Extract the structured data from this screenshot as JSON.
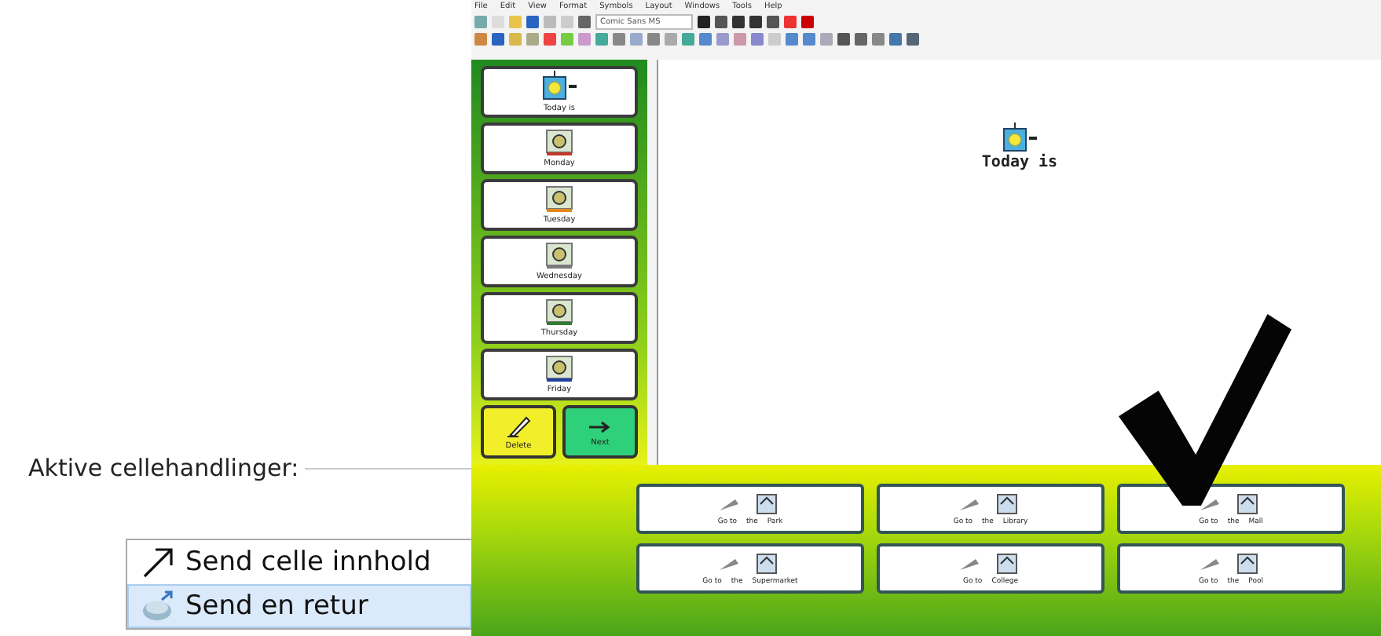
{
  "settings_panel": {
    "title": "Aktive cellehandlinger:",
    "actions": [
      {
        "label": "Send celle innhold",
        "selected": false
      },
      {
        "label": "Send en retur",
        "selected": true
      }
    ]
  },
  "editor": {
    "menu": [
      "File",
      "Edit",
      "View",
      "Format",
      "Symbols",
      "Layout",
      "Windows",
      "Tools",
      "Help"
    ],
    "font_name": "Comic Sans MS",
    "day_cells": [
      {
        "label": "Today is",
        "kind": "sun"
      },
      {
        "label": "Monday",
        "kind": "day",
        "color": "#c0392b"
      },
      {
        "label": "Tuesday",
        "kind": "day",
        "color": "#e08a1e"
      },
      {
        "label": "Wednesday",
        "kind": "day",
        "color": "#7a7a7a"
      },
      {
        "label": "Thursday",
        "kind": "day",
        "color": "#2e7d32"
      },
      {
        "label": "Friday",
        "kind": "day",
        "color": "#1f3fa0"
      }
    ],
    "tool_cells": [
      {
        "label": "Delete",
        "kind": "delete"
      },
      {
        "label": "Next",
        "kind": "next"
      }
    ],
    "document": {
      "text": "Today is"
    },
    "place_cells": [
      {
        "words": [
          "Go to",
          "the",
          "Park"
        ]
      },
      {
        "words": [
          "Go to",
          "the",
          "Library"
        ]
      },
      {
        "words": [
          "Go to",
          "the",
          "Mall"
        ]
      },
      {
        "words": [
          "Go to",
          "the",
          "Supermarket"
        ]
      },
      {
        "words": [
          "Go to",
          "College"
        ]
      },
      {
        "words": [
          "Go to",
          "the",
          "Pool"
        ]
      }
    ]
  }
}
